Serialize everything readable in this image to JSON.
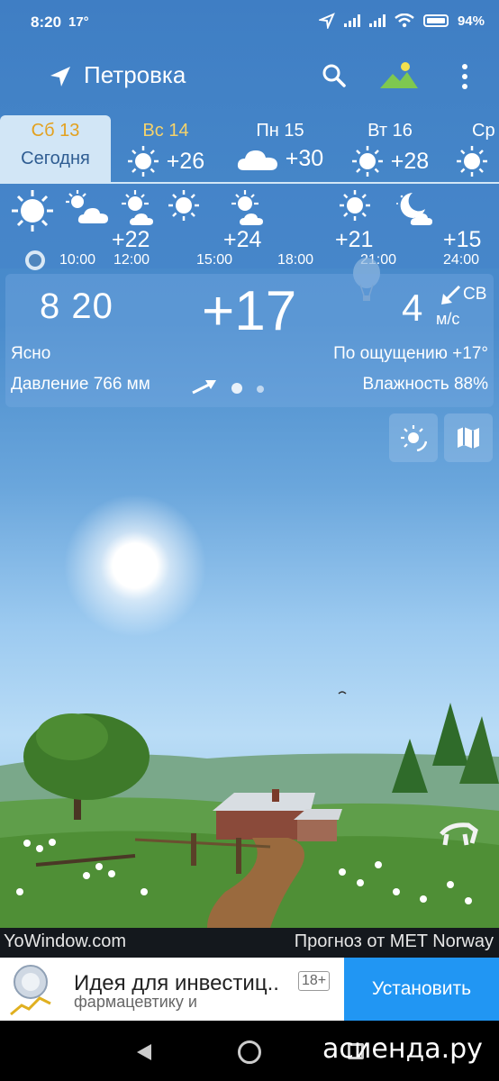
{
  "status_bar": {
    "time": "8:20",
    "temp": "17°",
    "battery": "94%"
  },
  "header": {
    "location": "Петровка"
  },
  "days": [
    {
      "name": "Сб 13",
      "sub": "Сегодня",
      "selected": true
    },
    {
      "name": "Вс 14",
      "temp": "+26",
      "icon": "sun-icon"
    },
    {
      "name": "Пн 15",
      "temp": "+30",
      "icon": "cloud-icon"
    },
    {
      "name": "Вт 16",
      "temp": "+28",
      "icon": "sun-icon"
    },
    {
      "name": "Ср",
      "icon": "sun-icon"
    }
  ],
  "hourly": {
    "temps": [
      "+22",
      "+24",
      "+21",
      "+15"
    ],
    "times": [
      "10:00",
      "12:00",
      "15:00",
      "18:00",
      "21:00",
      "24:00"
    ]
  },
  "current": {
    "time": "8 20",
    "temp": "+17",
    "wind_speed": "4",
    "wind_dir": "СВ",
    "wind_unit": "м/с",
    "condition": "Ясно",
    "feels_like": "По ощущению +17°",
    "pressure": "Давление 766 мм",
    "humidity": "Влажность 88%"
  },
  "footer": {
    "brand": "YoWindow.com",
    "source": "Прогноз от MET Norway"
  },
  "ad": {
    "title": "Идея для инвестиц..",
    "age": "18+",
    "subtitle": "фармацевтику и",
    "button": "Установить"
  },
  "watermark": "асиенда.ру",
  "colors": {
    "today_tab": "#d2e6f6",
    "weekend": "#f6d36b",
    "ad_button": "#2196f3"
  }
}
